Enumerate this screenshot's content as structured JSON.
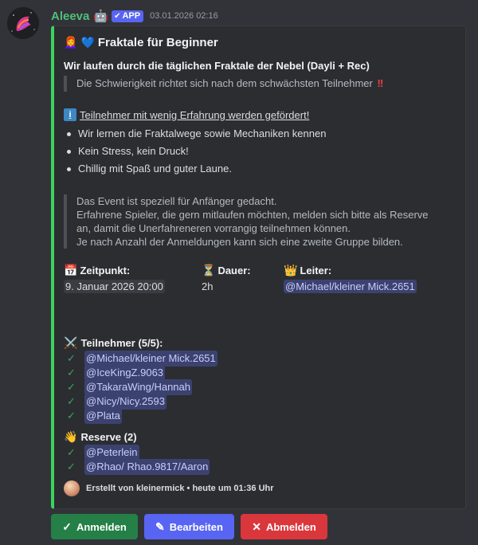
{
  "message": {
    "username": "Aleeva",
    "app_badge": "APP",
    "timestamp": "03.01.2026 02:16"
  },
  "embed": {
    "title": "Fraktale für Beginner",
    "subtitle": "Wir laufen durch die täglichen Fraktale der Nebel (Dayli + Rec)",
    "quote1": "Die Schwierigkeit richtet sich nach dem schwächsten Teilnehmer",
    "quote1_mark": "‼️",
    "info_line": "Teilnehmer mit wenig Erfahrung werden gefördert!",
    "bullets": [
      "Wir lernen die Fraktalwege sowie Mechaniken kennen",
      "Kein Stress, kein Druck!",
      "Chillig mit Spaß und guter Laune."
    ],
    "quote2": [
      "Das Event ist speziell für Anfänger gedacht.",
      "Erfahrene Spieler, die gern mitlaufen möchten, melden sich bitte als Reserve",
      "an, damit die Unerfahreneren vorrangig teilnehmen können.",
      "Je nach Anzahl der Anmeldungen kann sich eine zweite Gruppe bilden."
    ],
    "fields": {
      "zeitpunkt_label": "Zeitpunkt:",
      "zeitpunkt_value": "9. Januar 2026 20:00",
      "dauer_label": "Dauer:",
      "dauer_value": "2h",
      "leiter_label": "Leiter:",
      "leiter_value": "@Michael/kleiner Mick.2651"
    },
    "participants_header": "Teilnehmer (5/5):",
    "participants": [
      "@Michael/kleiner Mick.2651",
      "@IceKingZ.9063",
      "@TakaraWing/Hannah",
      "@Nicy/Nicy.2593",
      "@Plata"
    ],
    "reserve_header": "Reserve (2)",
    "reserve": [
      "@Peterlein",
      "@Rhao/ Rhao.9817/Aaron"
    ],
    "footer": "Erstellt von kleinermick • heute um 01:36 Uhr",
    "accent_color": "#3bd45c"
  },
  "buttons": {
    "join": "Anmelden",
    "edit": "Bearbeiten",
    "leave": "Abmelden"
  }
}
